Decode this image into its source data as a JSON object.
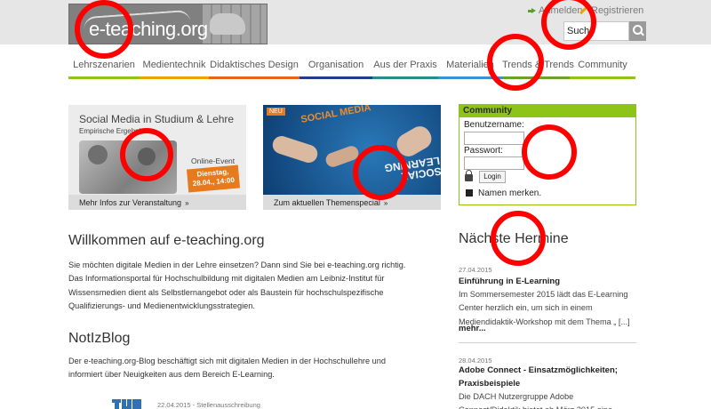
{
  "header": {
    "logo_text": "e-teaching.org",
    "login_label": "Anmelden",
    "register_label": "Registrieren",
    "search_value": "Suche"
  },
  "nav": {
    "items": [
      {
        "label": "Lehrszenarien",
        "color": "#8ec31a"
      },
      {
        "label": "Medientechnik",
        "color": "#e6a800"
      },
      {
        "label": "Didaktisches Design",
        "color": "#e8641e"
      },
      {
        "label": "Organisation",
        "color": "#1d3f8a"
      },
      {
        "label": "Aus der Praxis",
        "color": "#2b8a8a"
      },
      {
        "label": "Materialien",
        "color": "#3a92d2"
      },
      {
        "label": "Trends & Trends",
        "color": "#6aa12a"
      },
      {
        "label": "Community",
        "color": "#8ec31a"
      }
    ]
  },
  "banners": {
    "b1": {
      "title": "Social Media in Studium & Lehre",
      "subtitle": "Empirische Ergebnisse",
      "event_label": "Online-Event",
      "event_date": "Dienstag, 28.04., 14:00",
      "caption": "Mehr Infos zur Veranstaltung"
    },
    "b2": {
      "new_tag": "NEU",
      "social_media_text": "SOCIAL MEDIA",
      "social_learning_text": "SOCIAL LEARNING",
      "caption": "Zum aktuellen Themenspecial"
    },
    "arrows": "»"
  },
  "community": {
    "title": "Community",
    "username_label": "Benutzername:",
    "password_label": "Passwort:",
    "login_button": "Login",
    "remember_label": "Namen merken."
  },
  "main": {
    "welcome_title": "Willkommen auf e-teaching.org",
    "welcome_text": "Sie möchten digitale Medien in der Lehre einsetzen? Dann sind Sie bei e-teaching.org richtig. Das Informationsportal für Hochschulbildung mit digitalen Medien am Leibniz-Institut für Wissensmedien dient als Selbstlernangebot oder als Baustein für hochschulspezifische Qualifizierungs- und Medienentwicklungsstrategien.",
    "blog_title": "NotIzBlog",
    "blog_text": "Der e-teaching.org-Blog beschäftigt sich mit digitalen Medien in der Hochschullehre und informiert über Neuigkeiten aus dem Bereich E-Learning.",
    "blog_entry_meta": "22.04.2015 - Stellenausschreibung"
  },
  "events": {
    "title": "Nächste Hermine",
    "items": [
      {
        "date": "27.04.2015",
        "title": "Einführung in E-Learning",
        "text": "Im Sommersemester 2015 lädt das E-Learning Center herzlich ein, um sich in einem Mediendidaktik-Workshop mit dem Thema „ [...]",
        "more": "mehr..."
      },
      {
        "date": "28.04.2015",
        "title": "Adobe Connect - Einsatzmöglichkeiten; Praxisbeispiele",
        "text": "Die DACH Nutzergruppe Adobe Connect/Didaktik bietet ab März 2015 eine"
      }
    ]
  }
}
